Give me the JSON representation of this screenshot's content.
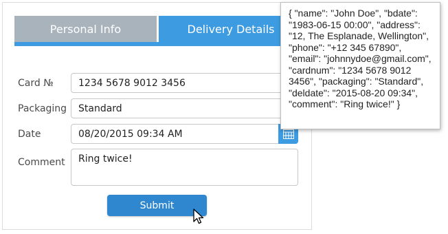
{
  "tabs": [
    {
      "label": "Personal Info",
      "active": false
    },
    {
      "label": "Delivery Details",
      "active": true
    }
  ],
  "form": {
    "card_label": "Card №",
    "card_value": "1234 5678 9012 3456",
    "packaging_label": "Packaging",
    "packaging_value": "Standard",
    "date_label": "Date",
    "date_value": "08/20/2015 09:34 AM",
    "comment_label": "Comment",
    "comment_value": "Ring twice!",
    "submit_label": "Submit"
  },
  "tooltip": {
    "text": "{ \"name\": \"John Doe\", \"bdate\": \"1983-06-15 00:00\", \"address\": \"12, The Esplanade, Wellington\", \"phone\": \"+12 345 67890\", \"email\": \"johnnydoe@gmail.com\", \"cardnum\": \"1234 5678 9012 3456\", \"packaging\": \"Standard\", \"deldate\": \"2015-08-20 09:34\", \"comment\": \"Ring twice!\" }"
  },
  "icons": {
    "calendar": "calendar-icon",
    "cursor": "mouse-pointer-icon"
  },
  "colors": {
    "accent": "#3d9be1",
    "inactive_tab": "#a9b3bc",
    "submit": "#2f88cf"
  }
}
